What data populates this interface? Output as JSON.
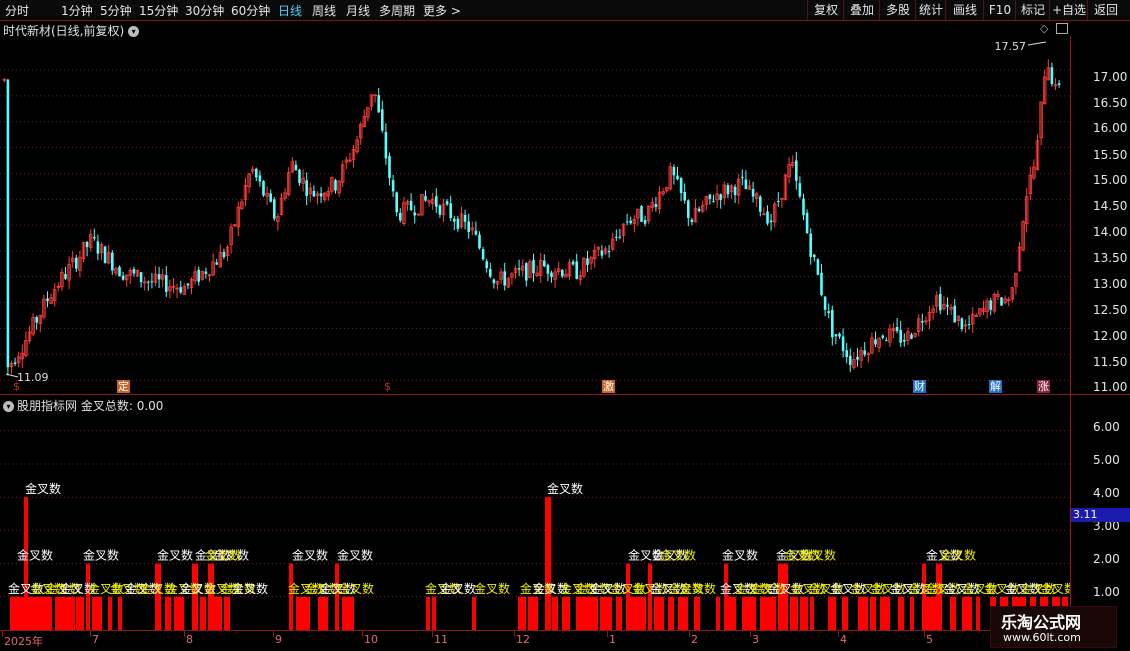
{
  "toolbar": {
    "periods": [
      "分时",
      "1分钟",
      "5分钟",
      "15分钟",
      "30分钟",
      "60分钟",
      "日线",
      "周线",
      "月线",
      "多周期",
      "更多 >"
    ],
    "active_period": "日线",
    "buttons": [
      "复权",
      "叠加",
      "多股",
      "统计",
      "画线",
      "F10",
      "标记",
      "+自选",
      "返回"
    ]
  },
  "main": {
    "title": "时代新材(日线,前复权)",
    "high_label": "17.57",
    "low_label": "11.09",
    "axis_labels": [
      "17.00",
      "16.50",
      "16.00",
      "15.50",
      "15.00",
      "14.50",
      "14.00",
      "13.50",
      "13.00",
      "12.50",
      "12.00",
      "11.50",
      "11.00"
    ],
    "markers": [
      {
        "text": "$",
        "color": "#c8321e"
      },
      {
        "text": "定",
        "color": "#c8641e"
      },
      {
        "text": "$",
        "color": "#c8321e"
      },
      {
        "text": "激",
        "color": "#c8641e"
      },
      {
        "text": "财",
        "color": "#1e6ec8"
      },
      {
        "text": "解",
        "color": "#1e6ec8"
      },
      {
        "text": "涨",
        "color": "#8a1e3c"
      }
    ]
  },
  "indicator": {
    "name": "股朋指标网",
    "series_label": "金叉总数:",
    "series_value": "0.00",
    "axis_labels": [
      "6.00",
      "5.00",
      "4.00",
      "3.00",
      "2.00",
      "1.00"
    ],
    "current_value": "3.11",
    "bar_label": "金叉数"
  },
  "dates": [
    "2025年",
    "7",
    "8",
    "9",
    "10",
    "11",
    "12",
    "1",
    "2",
    "3",
    "4",
    "5"
  ],
  "watermark": {
    "title": "乐淘公式网",
    "url": "www.60lt.com"
  },
  "colors": {
    "up": "#ff3c3c",
    "down": "#54ffff",
    "bar": "#ff0000",
    "grid": "#7a1a1a",
    "label": "#f0f000"
  }
}
